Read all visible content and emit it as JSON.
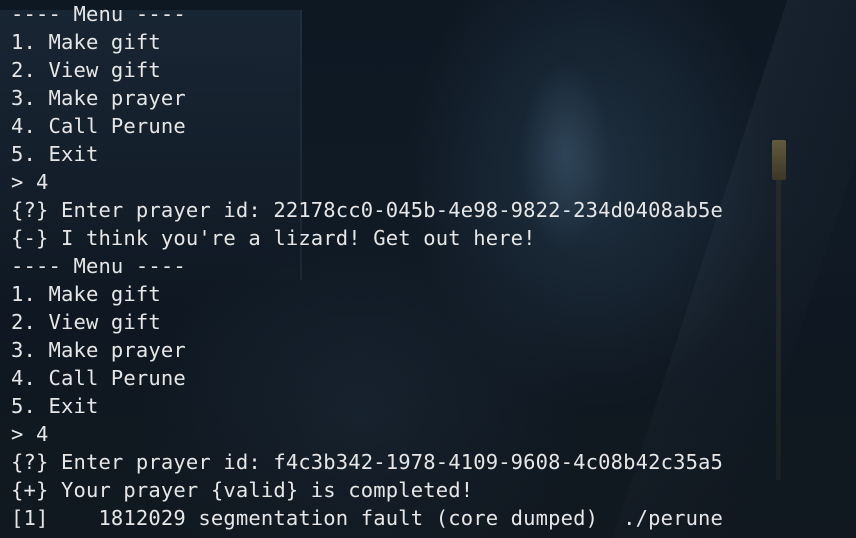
{
  "terminal": {
    "lines": [
      "---- Menu ----",
      "1. Make gift",
      "2. View gift",
      "3. Make prayer",
      "4. Call Perune",
      "5. Exit",
      "> 4",
      "{?} Enter prayer id: 22178cc0-045b-4e98-9822-234d0408ab5e",
      "{-} I think you're a lizard! Get out here!",
      "---- Menu ----",
      "1. Make gift",
      "2. View gift",
      "3. Make prayer",
      "4. Call Perune",
      "5. Exit",
      "> 4",
      "{?} Enter prayer id: f4c3b342-1978-4109-9608-4c08b42c35a5",
      "{+} Your prayer {valid} is completed!",
      "[1]    1812029 segmentation fault (core dumped)  ./perune"
    ]
  },
  "colors": {
    "text": "#e6e6e6",
    "background": "#0e1823"
  }
}
